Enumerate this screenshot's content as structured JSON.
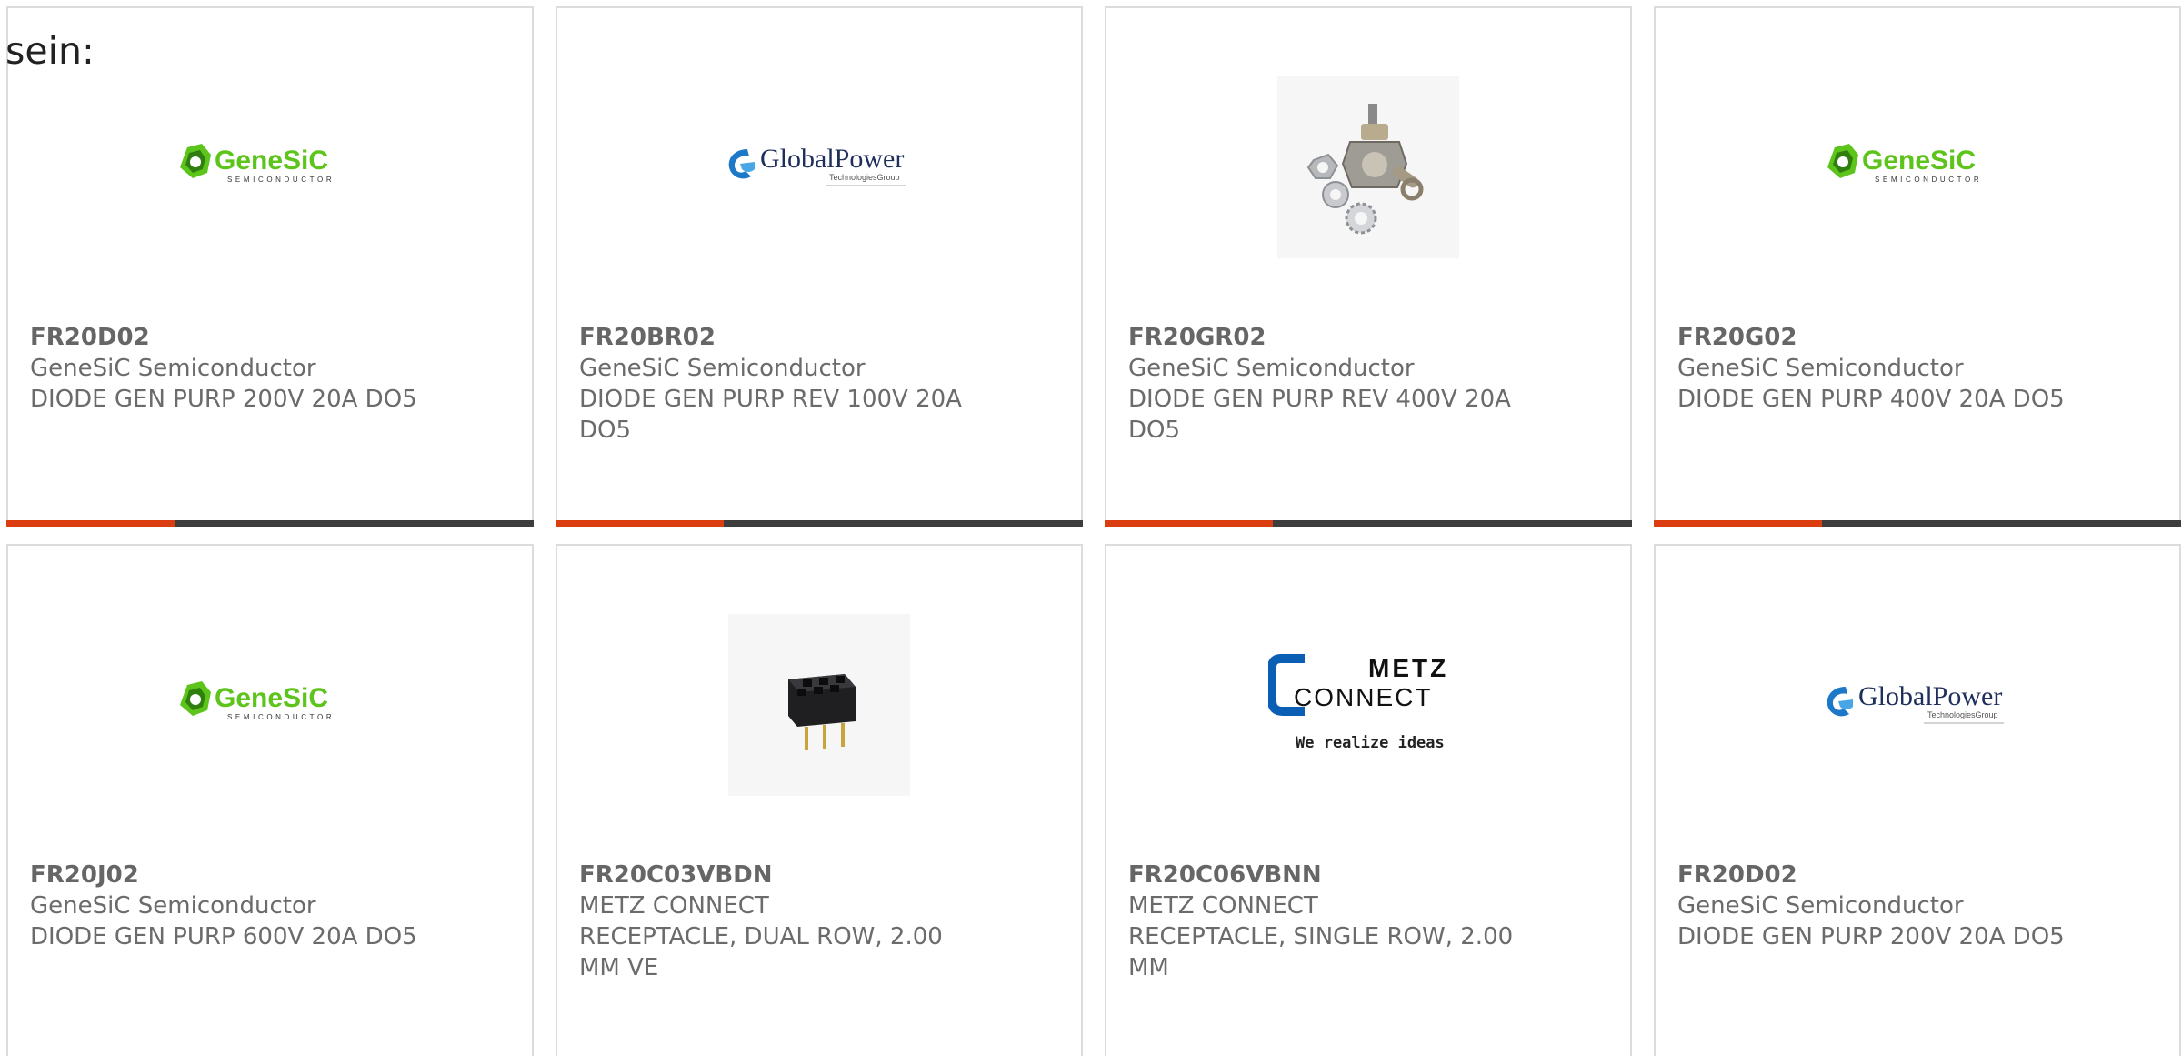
{
  "intro_text": "sein:",
  "colors": {
    "accent": "#d93d10",
    "bar_dark": "#3d3d3d",
    "genesic_green": "#5cc41a",
    "globalpower_blue": "#1e78c8",
    "metz_blue": "#0a5fb4"
  },
  "cards": [
    {
      "part_number": "FR20D02",
      "manufacturer": "GeneSiC Semiconductor",
      "description": "DIODE GEN PURP 200V 20A DO5",
      "image": "genesic-logo",
      "logo_name": "GeneSiC",
      "logo_sub": "SEMICONDUCTOR"
    },
    {
      "part_number": "FR20BR02",
      "manufacturer": "GeneSiC Semiconductor",
      "description": "DIODE GEN PURP REV 100V 20A DO5",
      "image": "globalpower-logo",
      "logo_name": "GlobalPower",
      "logo_sub": "TechnologiesGroup"
    },
    {
      "part_number": "FR20GR02",
      "manufacturer": "GeneSiC Semiconductor",
      "description": "DIODE GEN PURP REV 400V 20A DO5",
      "image": "stud-diode-photo"
    },
    {
      "part_number": "FR20G02",
      "manufacturer": "GeneSiC Semiconductor",
      "description": "DIODE GEN PURP 400V 20A DO5",
      "image": "genesic-logo",
      "logo_name": "GeneSiC",
      "logo_sub": "SEMICONDUCTOR"
    },
    {
      "part_number": "FR20J02",
      "manufacturer": "GeneSiC Semiconductor",
      "description": "DIODE GEN PURP 600V 20A DO5",
      "image": "genesic-logo",
      "logo_name": "GeneSiC",
      "logo_sub": "SEMICONDUCTOR"
    },
    {
      "part_number": "FR20C03VBDN",
      "manufacturer": "METZ CONNECT",
      "description": "RECEPTACLE, DUAL ROW, 2.00 MM VE",
      "image": "receptacle-photo"
    },
    {
      "part_number": "FR20C06VBNN",
      "manufacturer": "METZ CONNECT",
      "description": "RECEPTACLE, SINGLE ROW, 2.00 MM",
      "image": "metz-connect-logo",
      "logo_name_1": "METZ",
      "logo_name_2": "CONNECT",
      "logo_sub": "We realize ideas"
    },
    {
      "part_number": "FR20D02",
      "manufacturer": "GeneSiC Semiconductor",
      "description": "DIODE GEN PURP 200V 20A DO5",
      "image": "globalpower-logo",
      "logo_name": "GlobalPower",
      "logo_sub": "TechnologiesGroup"
    }
  ]
}
